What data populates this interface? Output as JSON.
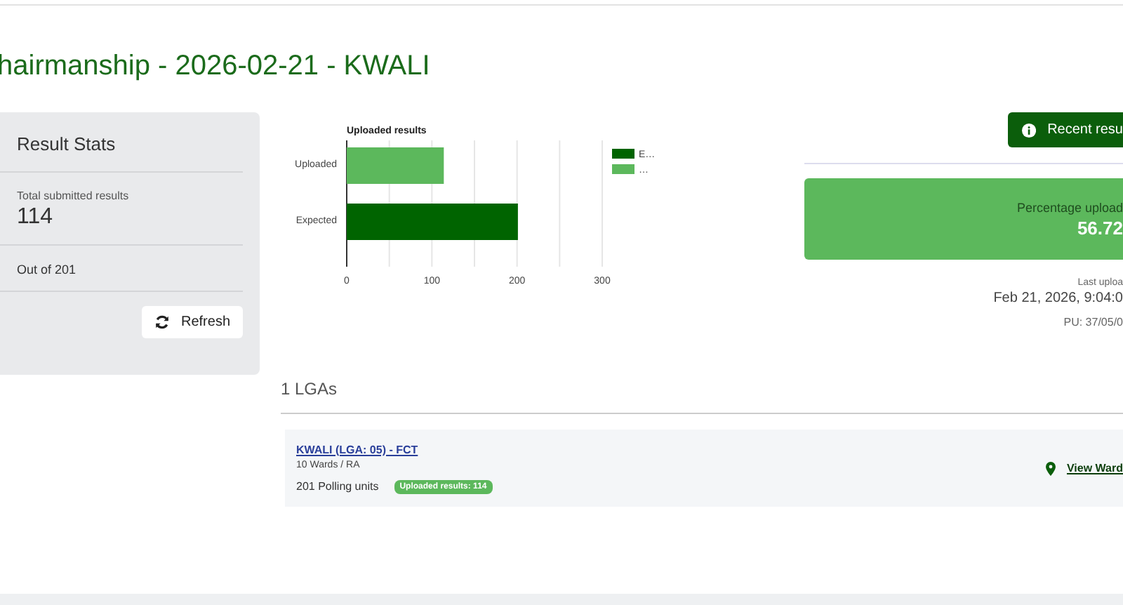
{
  "page_title": "hairmanship - 2026-02-21 - KWALI",
  "stats_card": {
    "title": "Result Stats",
    "total_label": "Total submitted results",
    "total_value": "114",
    "out_of": "Out of 201",
    "refresh_button": "Refresh"
  },
  "chart": {
    "chart_data": {
      "type": "bar",
      "orientation": "horizontal",
      "legend": "right",
      "title": "Uploaded results",
      "categories": [
        "Uploaded",
        "Expected"
      ],
      "xlim": [
        0,
        300
      ],
      "xticks": [
        0,
        100,
        200,
        300
      ],
      "series": [
        {
          "name": "E…",
          "color": "#006400",
          "values": [
            null,
            201
          ]
        },
        {
          "name": "…",
          "color": "#5cb85c",
          "values": [
            114,
            null
          ]
        }
      ]
    }
  },
  "recent_button": "Recent resu",
  "percentage": {
    "label": "Percentage upload",
    "value": "56.72"
  },
  "last_upload": {
    "label": "Last uploa",
    "time": "Feb 21, 2026, 9:04:0",
    "pu": "PU: 37/05/0"
  },
  "lga_heading": "1 LGAs",
  "lgas": [
    {
      "name": "KWALI (LGA: 05) - FCT",
      "wards": "10 Wards / RA",
      "polling_units": "201 Polling units",
      "badge": "Uploaded results: 114",
      "view_link": "View Ward"
    }
  ]
}
